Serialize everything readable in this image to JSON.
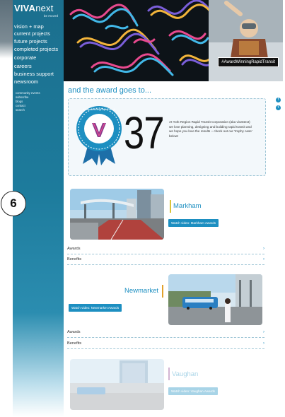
{
  "brand": {
    "logo_main": "VIVA",
    "logo_light": "next",
    "logo_sub": "be moved",
    "accent": "#1d8fc1",
    "sidebar_color": "#1d7b9c"
  },
  "nav": {
    "items": [
      "vision + map",
      "current projects",
      "future projects",
      "completed projects",
      "corporate",
      "careers",
      "business support",
      "newsroom"
    ],
    "sub_items": [
      "community events",
      "subscribe",
      "blogs",
      "contact",
      "search"
    ]
  },
  "hero": {
    "badge": "#AwardWinningRapidTransit"
  },
  "social": {
    "icons": [
      "facebook-icon",
      "twitter-icon"
    ],
    "facebook_glyph": "f",
    "twitter_glyph": "t"
  },
  "award": {
    "heading": "and the award goes to...",
    "medal_text": "#AwardWinningRapidTransit",
    "count": "37",
    "description": "At York Region Rapid Transit Corporation (aka vivaNext) we love planning, designing and building rapid transit and we hope you love the results – check out our 'trophy case' below!"
  },
  "page_number": "6",
  "projects": [
    {
      "name": "Markham",
      "button": "Watch video: Markham Awards",
      "bar_color": "#d9c43a",
      "rows": [
        "Awards",
        "Benefits"
      ]
    },
    {
      "name": "Newmarket",
      "button": "Watch video: Newmarket Awards",
      "bar_color": "#e2a12a",
      "rows": [
        "Awards",
        "Benefits"
      ]
    },
    {
      "name": "Vaughan",
      "button": "Watch video: Vaughan Awards",
      "bar_color": "#8a3c8e",
      "rows": []
    }
  ],
  "row_chevron": "›"
}
